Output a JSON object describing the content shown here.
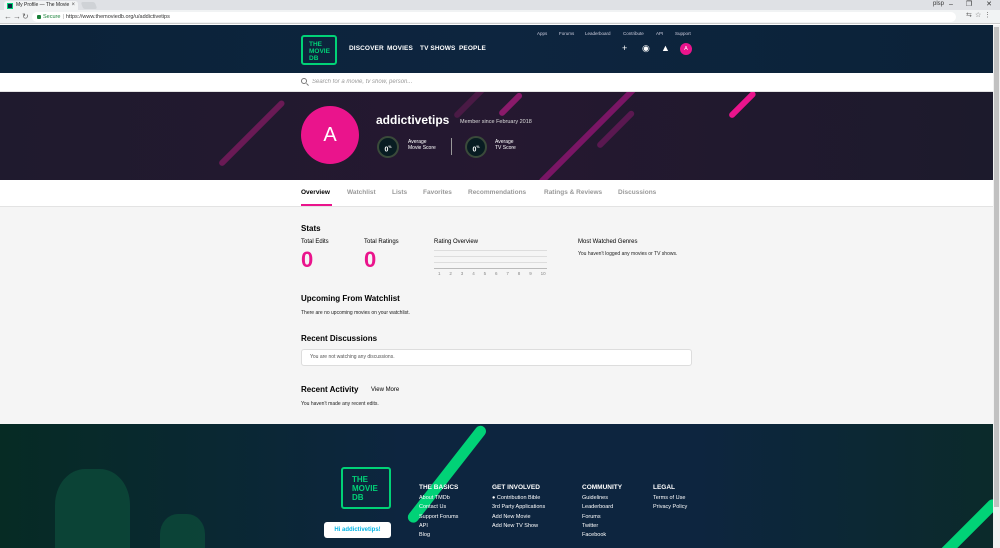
{
  "browser": {
    "tab_title": "My Profile — The Movie",
    "tab_close": "×",
    "user": "plsp",
    "window_controls": [
      "–",
      "❐",
      "✕"
    ],
    "secure_label": "Secure",
    "url": "https://www.themoviedb.org/u/addictivetips"
  },
  "header": {
    "logo_lines": [
      "THE",
      "MOVIE",
      "DB"
    ],
    "main_nav": [
      "DISCOVER",
      "MOVIES",
      "TV SHOWS",
      "PEOPLE"
    ],
    "top_nav": [
      "Apps",
      "Forums",
      "Leaderboard",
      "Contribute",
      "API",
      "Support"
    ],
    "avatar_letter": "A"
  },
  "search": {
    "placeholder": "Search for a movie, tv show, person..."
  },
  "profile": {
    "avatar_letter": "A",
    "username": "addictivetips",
    "member_since": "Member since February 2018",
    "movie_score": "0",
    "movie_score_label_1": "Average",
    "movie_score_label_2": "Movie Score",
    "tv_score": "0",
    "tv_score_label_1": "Average",
    "tv_score_label_2": "TV Score",
    "percent": "%"
  },
  "tabs": [
    "Overview",
    "Watchlist",
    "Lists",
    "Favorites",
    "Recommendations",
    "Ratings & Reviews",
    "Discussions"
  ],
  "stats": {
    "title": "Stats",
    "total_edits_label": "Total Edits",
    "total_edits": "0",
    "total_ratings_label": "Total Ratings",
    "total_ratings": "0",
    "rating_overview_label": "Rating Overview",
    "rating_ticks": [
      "1",
      "2",
      "3",
      "4",
      "5",
      "6",
      "7",
      "8",
      "9",
      "10"
    ],
    "genres_label": "Most Watched Genres",
    "genres_empty": "You haven't logged any movies or TV shows."
  },
  "watchlist": {
    "title": "Upcoming From Watchlist",
    "empty": "There are no upcoming movies on your watchlist."
  },
  "discussions": {
    "title": "Recent Discussions",
    "empty": "You are not watching any discussions."
  },
  "activity": {
    "title": "Recent Activity",
    "view_more": "View More",
    "empty": "You haven't made any recent edits."
  },
  "footer": {
    "logo_lines": [
      "THE",
      "MOVIE",
      "DB"
    ],
    "hi_button": "Hi addictivetips!",
    "columns": [
      {
        "title": "THE BASICS",
        "links": [
          "About TMDb",
          "Contact Us",
          "Support Forums",
          "API",
          "Blog"
        ]
      },
      {
        "title": "GET INVOLVED",
        "links": [
          "Contribution Bible",
          "3rd Party Applications",
          "Add New Movie",
          "Add New TV Show"
        ]
      },
      {
        "title": "COMMUNITY",
        "links": [
          "Guidelines",
          "Leaderboard",
          "Forums",
          "Twitter",
          "Facebook"
        ]
      },
      {
        "title": "LEGAL",
        "links": [
          "Terms of Use",
          "Privacy Policy"
        ]
      }
    ]
  },
  "colors": {
    "navy": "#0d253f",
    "green": "#01d277",
    "pink": "#ea148c"
  }
}
